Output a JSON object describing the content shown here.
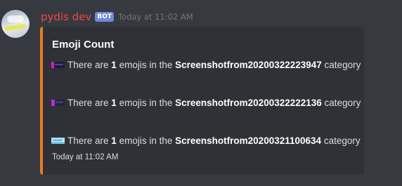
{
  "message": {
    "author": "pydis dev",
    "bot_tag": "BOT",
    "timestamp": "Today at 11:02 AM",
    "avatar_icon": "landscape-avatar-icon"
  },
  "embed": {
    "accent_color": "#e67e22",
    "title": "Emoji Count",
    "rows": [
      {
        "emoji_icon": "custom-emoji-screenshot-icon",
        "prefix": "There are",
        "count": "1",
        "middle": "emojis in the",
        "category": "Screenshotfrom20200322223947",
        "suffix": "category"
      },
      {
        "emoji_icon": "custom-emoji-screenshot-icon",
        "prefix": "There are",
        "count": "1",
        "middle": "emojis in the",
        "category": "Screenshotfrom20200322222136",
        "suffix": "category"
      },
      {
        "emoji_icon": "custom-emoji-screenshot-icon",
        "prefix": "There are",
        "count": "1",
        "middle": "emojis in the",
        "category": "Screenshotfrom20200321100634",
        "suffix": "category"
      }
    ],
    "footer": "Today at 11:02 AM"
  },
  "colors": {
    "background": "#36393f",
    "embed_background": "#2f3136",
    "username": "#f04747",
    "bot_tag": "#7289da",
    "timestamp": "#72767d",
    "text": "#dcddde"
  }
}
